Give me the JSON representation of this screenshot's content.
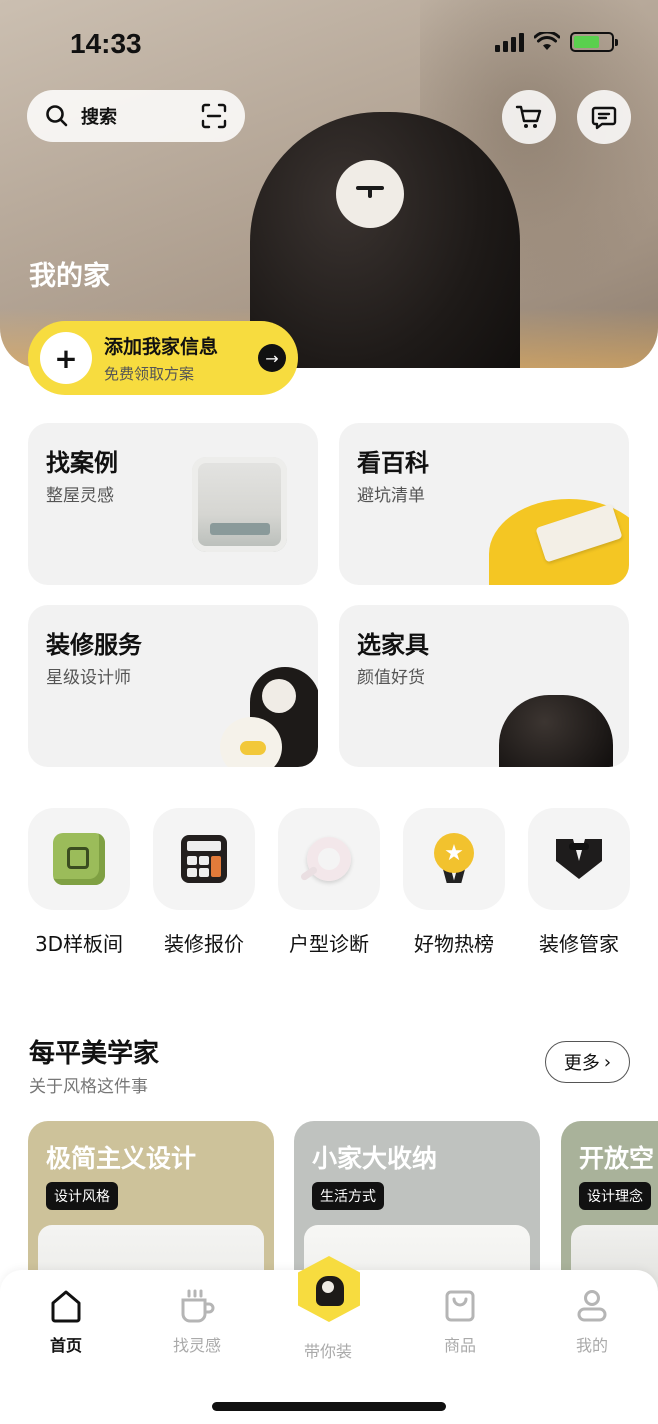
{
  "status_bar": {
    "time": "14:33"
  },
  "header": {
    "search_label": "搜索",
    "title": "我的家"
  },
  "add_home": {
    "title": "添加我家信息",
    "subtitle": "免费领取方案"
  },
  "feature_cards": [
    {
      "title": "找案例",
      "subtitle": "整屋灵感"
    },
    {
      "title": "看百科",
      "subtitle": "避坑清单"
    },
    {
      "title": "装修服务",
      "subtitle": "星级设计师"
    },
    {
      "title": "选家具",
      "subtitle": "颜值好货"
    }
  ],
  "quick_icons": [
    {
      "label": "3D样板间",
      "icon": "3d-cube-icon"
    },
    {
      "label": "装修报价",
      "icon": "calculator-icon"
    },
    {
      "label": "户型诊断",
      "icon": "magnifier-ring-icon"
    },
    {
      "label": "好物热榜",
      "icon": "medal-icon"
    },
    {
      "label": "装修管家",
      "icon": "tuxedo-icon"
    }
  ],
  "section": {
    "title": "每平美学家",
    "subtitle": "关于风格这件事",
    "more_label": "更多"
  },
  "style_cards": [
    {
      "title": "极简主义设计",
      "tag": "设计风格",
      "color": "#cdc29a"
    },
    {
      "title": "小家大收纳",
      "tag": "生活方式",
      "color": "#bfc2bf"
    },
    {
      "title": "开放空",
      "tag": "设计理念",
      "color": "#a9b29a"
    }
  ],
  "tabbar": {
    "items": [
      {
        "label": "首页",
        "icon": "home-icon",
        "active": true
      },
      {
        "label": "找灵感",
        "icon": "cup-icon",
        "active": false
      },
      {
        "label": "带你装",
        "icon": "mascot-icon",
        "active": false
      },
      {
        "label": "商品",
        "icon": "bag-icon",
        "active": false
      },
      {
        "label": "我的",
        "icon": "person-icon",
        "active": false
      }
    ]
  },
  "colors": {
    "accent": "#f7dc3f",
    "text": "#111111",
    "muted": "#aaaaaa"
  }
}
